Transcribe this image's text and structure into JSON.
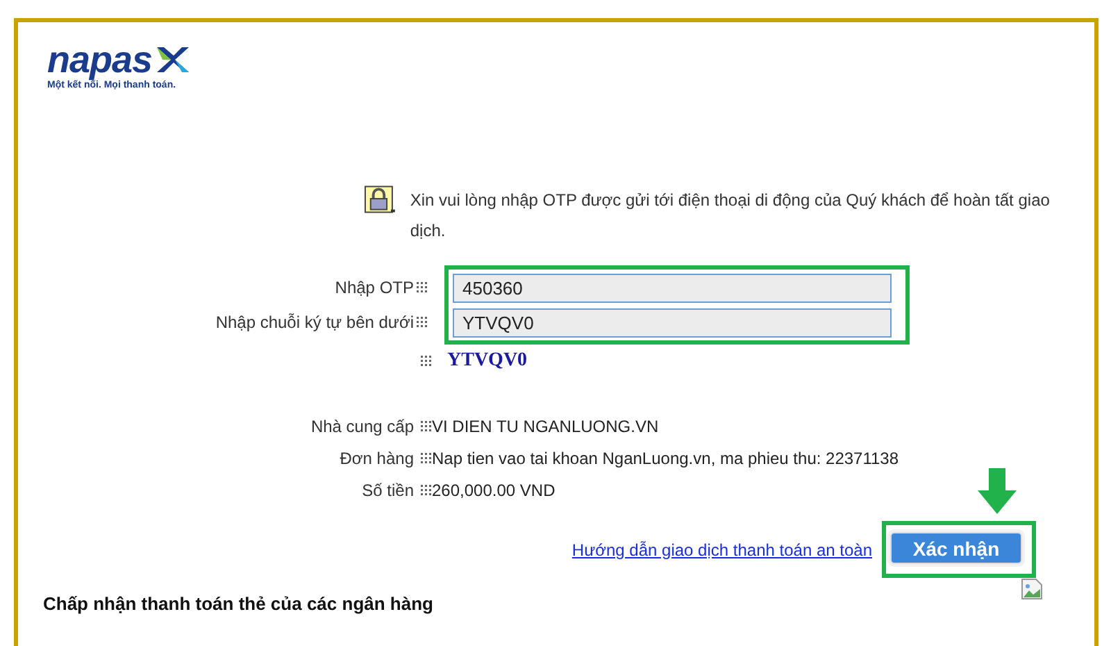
{
  "logo": {
    "name": "napas",
    "tagline": "Một kết nối. Mọi thanh toán."
  },
  "notice": "Xin vui lòng nhập OTP được gửi tới điện thoại di động của Quý khách để hoàn tất giao dịch.",
  "otp_fields": [
    {
      "label": "Nhập OTP",
      "value": "450360"
    },
    {
      "label": "Nhập chuỗi ký tự bên dưới",
      "value": "YTVQV0"
    }
  ],
  "captcha": "YTVQV0",
  "details": [
    {
      "label": "Nhà cung cấp",
      "value": "VI DIEN TU NGANLUONG.VN"
    },
    {
      "label": "Đơn hàng",
      "value": "Nap tien vao tai khoan NganLuong.vn, ma phieu thu: 22371138"
    },
    {
      "label": "Số tiền",
      "value": "260,000.00 VND"
    }
  ],
  "help_link": "Hướng dẫn giao dịch thanh toán an toàn",
  "confirm_button": "Xác nhận",
  "footer_heading": "Chấp nhận thanh toán thẻ của các ngân hàng"
}
